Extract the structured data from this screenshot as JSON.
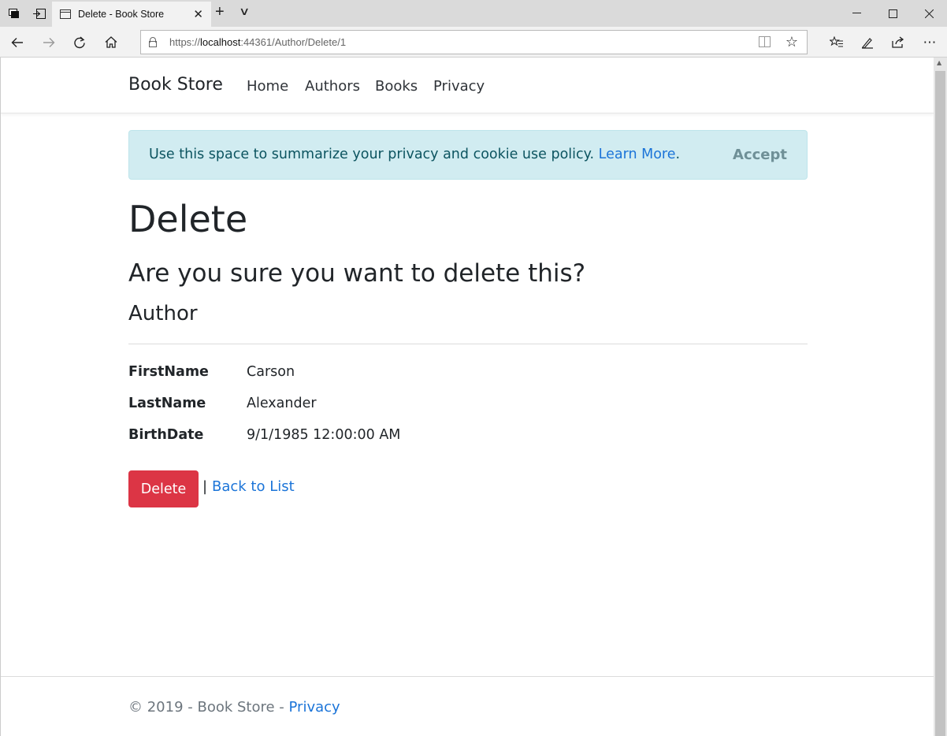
{
  "browser": {
    "tab_title": "Delete - Book Store",
    "url_prefix": "https://",
    "url_host": "localhost",
    "url_rest": ":44361/Author/Delete/1"
  },
  "site": {
    "brand": "Book Store",
    "nav": [
      "Home",
      "Authors",
      "Books",
      "Privacy"
    ]
  },
  "cookie": {
    "text": "Use this space to summarize your privacy and cookie use policy.",
    "link": "Learn More",
    "period": ".",
    "accept": "Accept"
  },
  "page": {
    "title": "Delete",
    "question": "Are you sure you want to delete this?",
    "entity": "Author"
  },
  "details": [
    {
      "label": "FirstName",
      "value": "Carson"
    },
    {
      "label": "LastName",
      "value": "Alexander"
    },
    {
      "label": "BirthDate",
      "value": "9/1/1985 12:00:00 AM"
    }
  ],
  "actions": {
    "delete": "Delete",
    "separator": "|",
    "back": "Back to List"
  },
  "footer": {
    "copyright": "© 2019 - Book Store - ",
    "privacy": "Privacy"
  },
  "colors": {
    "danger": "#dc3545",
    "link": "#1b74d8",
    "alert_bg": "#d1ecf1"
  }
}
